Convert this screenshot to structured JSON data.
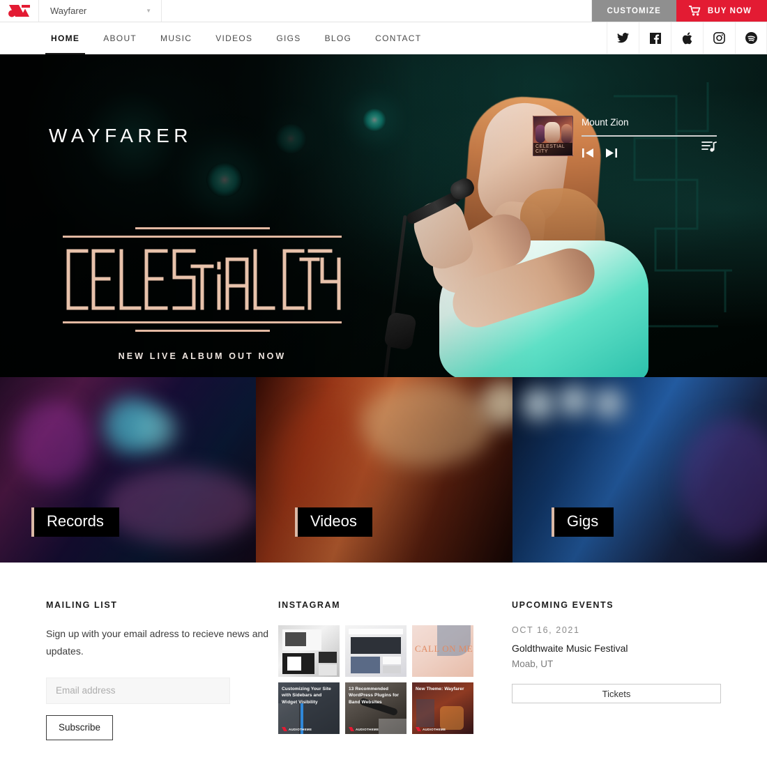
{
  "admin_bar": {
    "logo_icon": "audiotheme-logo-icon",
    "theme_name": "Wayfarer",
    "caret_icon": "chevron-down-icon",
    "customize_label": "CUSTOMIZE",
    "buy_label": "BUY NOW",
    "cart_icon": "shopping-cart-icon",
    "buy_color": "#e31b33",
    "customize_color": "#8f8f8f"
  },
  "nav": {
    "items": [
      {
        "label": "HOME",
        "active": true
      },
      {
        "label": "ABOUT",
        "active": false
      },
      {
        "label": "MUSIC",
        "active": false
      },
      {
        "label": "VIDEOS",
        "active": false
      },
      {
        "label": "GIGS",
        "active": false
      },
      {
        "label": "BLOG",
        "active": false
      },
      {
        "label": "CONTACT",
        "active": false
      }
    ],
    "social": [
      {
        "name": "twitter-icon"
      },
      {
        "name": "facebook-icon"
      },
      {
        "name": "apple-music-icon"
      },
      {
        "name": "instagram-icon"
      },
      {
        "name": "spotify-icon"
      }
    ]
  },
  "hero": {
    "brand": "WAYFARER",
    "album_title": "CELESTIAL CITY",
    "album_subtitle": "NEW LIVE ALBUM OUT NOW",
    "accent_color": "#e3b9a2"
  },
  "player": {
    "album_art_label": "CELESTIAL CITY",
    "track_title": "Mount Zion",
    "prev_icon": "skip-previous-icon",
    "next_icon": "skip-next-icon",
    "playlist_icon": "playlist-queue-icon",
    "progress_percent": 0
  },
  "tiles": [
    {
      "label": "Records",
      "key": "records"
    },
    {
      "label": "Videos",
      "key": "videos"
    },
    {
      "label": "Gigs",
      "key": "gigs"
    }
  ],
  "footer": {
    "mailing": {
      "title": "MAILING LIST",
      "copy": "Sign up with your email adress to recieve news and updates.",
      "email_placeholder": "Email address",
      "email_value": "",
      "subscribe_label": "Subscribe"
    },
    "instagram": {
      "title": "INSTAGRAM",
      "posts": [
        {
          "caption": "",
          "variant": "ig1"
        },
        {
          "caption": "",
          "variant": "ig2"
        },
        {
          "caption": "CALL ON ME",
          "variant": "ig3"
        },
        {
          "caption": "Customizing Your Site with Sidebars and Widget Visibility",
          "variant": "ig4",
          "brand": "AUDIOTHEME"
        },
        {
          "caption": "13 Recommended WordPress Plugins for Band Websites",
          "variant": "ig5",
          "brand": "AUDIOTHEME"
        },
        {
          "caption": "New Theme: Wayfarer",
          "variant": "ig6",
          "brand": "AUDIOTHEME"
        }
      ]
    },
    "events": {
      "title": "UPCOMING EVENTS",
      "date": "OCT 16, 2021",
      "name": "Goldthwaite Music Festival",
      "venue": "Moab, UT",
      "tickets_label": "Tickets"
    }
  }
}
